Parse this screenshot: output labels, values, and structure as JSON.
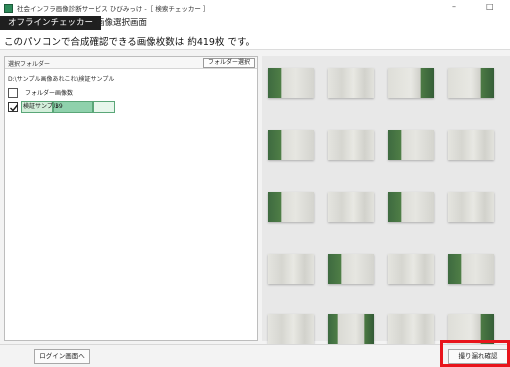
{
  "window": {
    "title": "社会インフラ画像診断サービス ひびみっけ -［ 検索チェッカー ］",
    "minimize_glyph": "–",
    "maximize_glyph": "□"
  },
  "tabs": {
    "active_label": "オフラインチェッカー",
    "page_label": "画像選択画面"
  },
  "info": {
    "text": "このパソコンで合成確認できる画像枚数は 約419枚 です。"
  },
  "left_panel": {
    "header_label": "選択フォルダー",
    "folder_button": "フォルダー選択",
    "path": "D:\\サンプル画像あれこれ\\検証サンプル",
    "columns": [
      "フォルダー",
      "画像数"
    ],
    "rows": [
      {
        "folder": "検証サンプル",
        "count": "39",
        "checked": true
      }
    ]
  },
  "gallery": {
    "thumbnails": [
      "green-left",
      "concrete",
      "green-right",
      "green-right",
      "green-left",
      "concrete",
      "green-left",
      "concrete",
      "green-left",
      "concrete",
      "green-left",
      "concrete",
      "concrete",
      "green-left",
      "concrete",
      "green-left",
      "concrete",
      "green-both",
      "concrete",
      "green-right"
    ]
  },
  "footer": {
    "login_button": "ログイン画面へ",
    "next_button": "撮り漏れ確認"
  },
  "colors": {
    "highlight": "#e8141b",
    "tab_active_bg": "#1f1f1f",
    "row_selected": "#8fd1ac"
  }
}
